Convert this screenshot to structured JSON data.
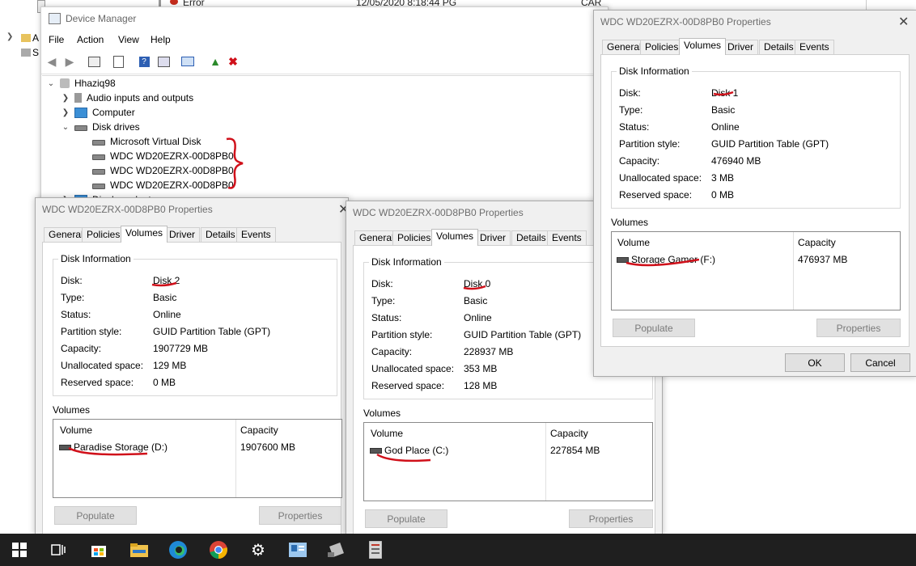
{
  "background": {
    "row_status": "Error",
    "row_time": "12/05/2020 8:18:44 PG",
    "row_source": "CAR",
    "explorer_items": [
      "A",
      "S"
    ]
  },
  "device_manager": {
    "title": "Device Manager",
    "menu": [
      "File",
      "Action",
      "View",
      "Help"
    ],
    "tree": {
      "root": "Hhaziq98",
      "audio": "Audio inputs and outputs",
      "computer": "Computer",
      "disk_drives": "Disk drives",
      "disks": [
        "Microsoft Virtual Disk",
        "WDC WD20EZRX-00D8PB0",
        "WDC WD20EZRX-00D8PB0",
        "WDC WD20EZRX-00D8PB0"
      ],
      "display": "Display adapters"
    }
  },
  "tabs": [
    "General",
    "Policies",
    "Volumes",
    "Driver",
    "Details",
    "Events"
  ],
  "labels": {
    "disk_information": "Disk Information",
    "disk": "Disk:",
    "type": "Type:",
    "status": "Status:",
    "partition_style": "Partition style:",
    "capacity": "Capacity:",
    "unallocated": "Unallocated space:",
    "reserved": "Reserved space:",
    "volumes": "Volumes",
    "col_volume": "Volume",
    "col_capacity": "Capacity",
    "populate": "Populate",
    "properties": "Properties",
    "ok": "OK",
    "cancel": "Cancel"
  },
  "dialogs": {
    "d2": {
      "title": "WDC WD20EZRX-00D8PB0 Properties",
      "disk": "Disk 2",
      "type": "Basic",
      "status": "Online",
      "partition_style": "GUID Partition Table (GPT)",
      "capacity": "1907729 MB",
      "unallocated": "129 MB",
      "reserved": "0 MB",
      "volume": "Paradise Storage (D:)",
      "volume_capacity": "1907600 MB"
    },
    "d0": {
      "title": "WDC WD20EZRX-00D8PB0 Properties",
      "disk": "Disk 0",
      "type": "Basic",
      "status": "Online",
      "partition_style": "GUID Partition Table (GPT)",
      "capacity": "228937 MB",
      "unallocated": "353 MB",
      "reserved": "128 MB",
      "volume": "God Place (C:)",
      "volume_capacity": "227854 MB"
    },
    "d1": {
      "title": "WDC WD20EZRX-00D8PB0 Properties",
      "disk": "Disk 1",
      "type": "Basic",
      "status": "Online",
      "partition_style": "GUID Partition Table (GPT)",
      "capacity": "476940 MB",
      "unallocated": "3 MB",
      "reserved": "0 MB",
      "volume": "Storage Gamer (F:)",
      "volume_capacity": "476937 MB"
    }
  },
  "taskbar": {
    "icons": [
      "windows-start-icon",
      "task-view-icon",
      "store-icon",
      "file-explorer-icon",
      "edge-icon",
      "chrome-icon",
      "settings-icon",
      "app-icon",
      "device-icon",
      "notes-icon"
    ]
  },
  "colors": {
    "annotation": "#d0101a",
    "taskbar": "#1f1f1f",
    "dialog": "#f0f0f0"
  }
}
